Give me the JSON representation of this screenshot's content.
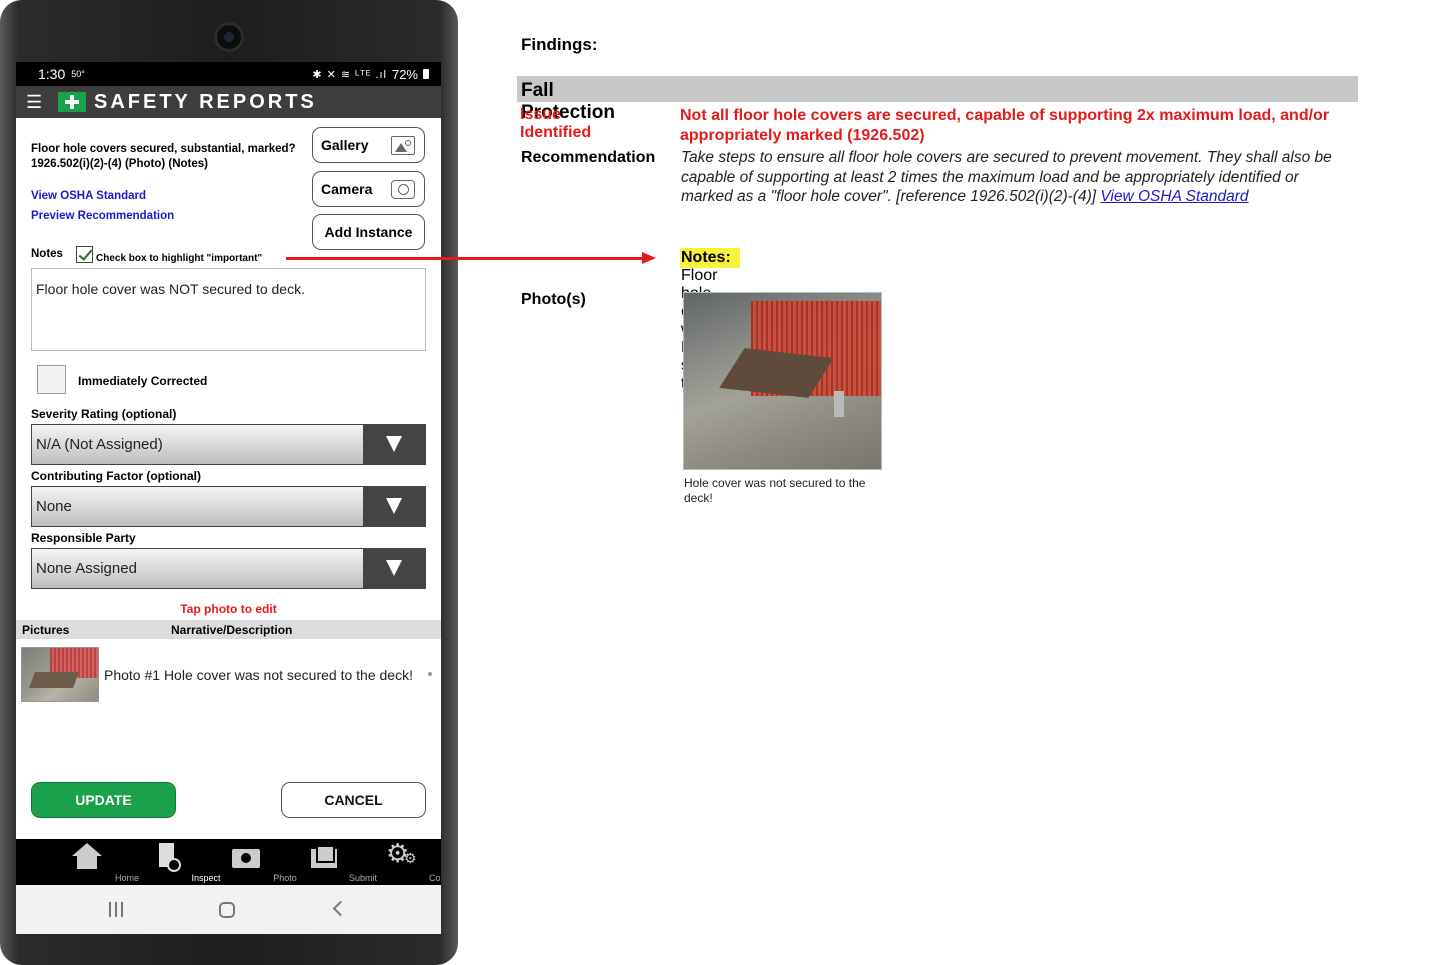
{
  "phone": {
    "status": {
      "time": "1:30",
      "temp": "50°",
      "icons": "✱ ✕ ≋ ᴸᵀᴱ .ıl",
      "battery": "72%"
    },
    "appbar": {
      "title": "SAFETY REPORTS",
      "menu_icon": "hamburger-icon"
    },
    "question": "Floor hole covers secured, substantial, marked? 1926.502(i)(2)-(4) (Photo) (Notes)",
    "links": {
      "view_osha": "View OSHA Standard",
      "preview_rec": "Preview Recommendation"
    },
    "buttons": {
      "gallery": "Gallery",
      "camera": "Camera",
      "add_instance": "Add Instance"
    },
    "notes": {
      "label": "Notes",
      "important_hint": "Check box to highlight \"important\"",
      "important_checked": true,
      "value": "Floor hole cover was NOT secured to deck."
    },
    "immediately_corrected": {
      "label": "Immediately Corrected",
      "checked": false
    },
    "severity": {
      "label": "Severity Rating (optional)",
      "value": "N/A (Not Assigned)"
    },
    "contributing": {
      "label": "Contributing Factor (optional)",
      "value": "None"
    },
    "responsible": {
      "label": "Responsible Party",
      "value": "None Assigned"
    },
    "tap_edit": "Tap photo to edit",
    "pictures": {
      "col_pictures": "Pictures",
      "col_narrative": "Narrative/Description",
      "rows": [
        {
          "description": "Photo #1 Hole cover was not secured to the deck!"
        }
      ]
    },
    "actions": {
      "update": "UPDATE",
      "cancel": "CANCEL"
    },
    "nav": {
      "home": "Home",
      "inspect": "Inspect",
      "photo": "Photo",
      "submit": "Submit",
      "config": "Config"
    }
  },
  "report": {
    "findings": "Findings:",
    "section": "Fall Protection",
    "issue_label": "Issue Identified",
    "issue_text": "Not all floor hole covers are secured, capable of supporting 2x maximum load, and/or appropriately marked (1926.502)",
    "rec_label": "Recommendation",
    "rec_text": "Take steps to ensure all floor hole covers are secured to prevent movement. They shall also be capable of supporting at least 2 times the maximum load and be appropriately identified or marked as a \"floor hole cover\". [reference 1926.502(i)(2)-(4)] ",
    "rec_link": "View OSHA Standard",
    "notes_label": "Notes:",
    "notes_text": " Floor hole cover was NOT secured to deck.",
    "photos_label": "Photo(s)",
    "photo_caption": "Hole cover was not secured to the deck!"
  },
  "colors": {
    "brand_green": "#1aa24a",
    "alert_red": "#e31b1b",
    "link_blue": "#1a1acc",
    "highlight_yellow": "#f7f43a"
  }
}
